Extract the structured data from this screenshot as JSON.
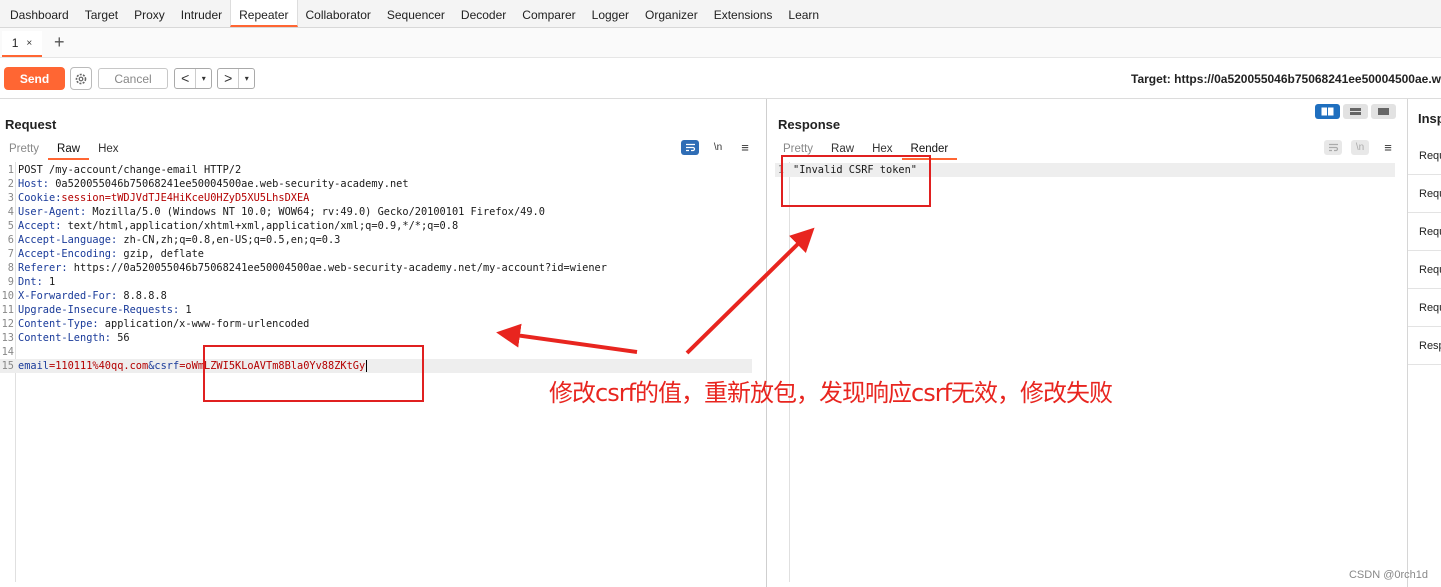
{
  "nav_tabs": [
    "Dashboard",
    "Target",
    "Proxy",
    "Intruder",
    "Repeater",
    "Collaborator",
    "Sequencer",
    "Decoder",
    "Comparer",
    "Logger",
    "Organizer",
    "Extensions",
    "Learn"
  ],
  "active_nav_tab": "Repeater",
  "repeater_tab": {
    "label": "1",
    "close": "×",
    "add": "+"
  },
  "toolbar": {
    "send_label": "Send",
    "cancel_label": "Cancel",
    "back_arrow": "<",
    "forward_arrow": ">",
    "dropdown": "▾",
    "target_label": "Target: https://0a520055046b75068241ee50004500ae.w"
  },
  "request": {
    "title": "Request",
    "view_tabs": [
      "Pretty",
      "Raw",
      "Hex"
    ],
    "active_view": "Raw",
    "newline_toggle": "\\n",
    "menu": "≡",
    "lines": [
      {
        "n": "1",
        "key": "",
        "val": "",
        "plain": "POST /my-account/change-email HTTP/2"
      },
      {
        "n": "2",
        "key": "Host:",
        "val": "",
        "plain": " 0a520055046b75068241ee50004500ae.web-security-academy.net"
      },
      {
        "n": "3",
        "key": "Cookie:",
        "val": "session=tWDJVdTJE4HiKceU0HZyD5XU5LhsDXEA",
        "plain": ""
      },
      {
        "n": "4",
        "key": "User-Agent:",
        "val": "",
        "plain": " Mozilla/5.0 (Windows NT 10.0; WOW64; rv:49.0) Gecko/20100101 Firefox/49.0"
      },
      {
        "n": "5",
        "key": "Accept:",
        "val": "",
        "plain": " text/html,application/xhtml+xml,application/xml;q=0.9,*/*;q=0.8"
      },
      {
        "n": "6",
        "key": "Accept-Language:",
        "val": "",
        "plain": " zh-CN,zh;q=0.8,en-US;q=0.5,en;q=0.3"
      },
      {
        "n": "7",
        "key": "Accept-Encoding:",
        "val": "",
        "plain": " gzip, deflate"
      },
      {
        "n": "8",
        "key": "Referer:",
        "val": "",
        "plain": " https://0a520055046b75068241ee50004500ae.web-security-academy.net/my-account?id=wiener"
      },
      {
        "n": "9",
        "key": "Dnt:",
        "val": "",
        "plain": " 1"
      },
      {
        "n": "10",
        "key": "X-Forwarded-For:",
        "val": "",
        "plain": " 8.8.8.8"
      },
      {
        "n": "11",
        "key": "Upgrade-Insecure-Requests:",
        "val": "",
        "plain": " 1"
      },
      {
        "n": "12",
        "key": "Content-Type:",
        "val": "",
        "plain": " application/x-www-form-urlencoded"
      },
      {
        "n": "13",
        "key": "Content-Length:",
        "val": "",
        "plain": " 56"
      },
      {
        "n": "14",
        "key": "",
        "val": "",
        "plain": ""
      }
    ],
    "body_line": {
      "n": "15",
      "k1": "email",
      "v1": "=110111%40qq.com",
      "amp": "&",
      "k2": "csrf",
      "v2": "=oWmLZWI5KLoAVTm8Bla0Yv88ZKtGy"
    }
  },
  "response": {
    "title": "Response",
    "view_tabs": [
      "Pretty",
      "Raw",
      "Hex",
      "Render"
    ],
    "active_view": "Render",
    "newline_toggle": "\\n",
    "menu": "≡",
    "line_number": "1",
    "body": "\"Invalid CSRF token\""
  },
  "inspector": {
    "title": "Insp",
    "items": [
      "Requ",
      "Requ",
      "Requ",
      "Requ",
      "Requ",
      "Resp"
    ]
  },
  "annotation": "修改csrf的值，重新放包，发现响应csrf无效，修改失败",
  "watermark": "CSDN @0rch1d",
  "colors": {
    "accent": "#ff6633",
    "annotation": "#e8251f",
    "layout_active": "#1f6fbf"
  }
}
